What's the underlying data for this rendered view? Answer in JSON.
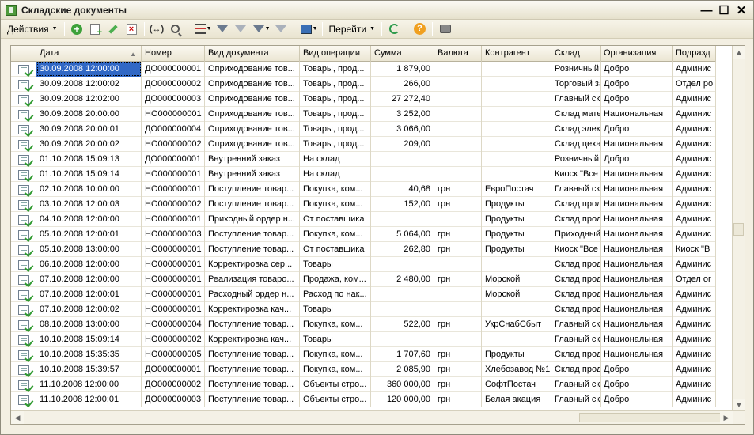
{
  "window": {
    "title": "Складские документы",
    "minimize": "—",
    "maximize": "☐",
    "close": "✕"
  },
  "toolbar": {
    "actions_label": "Действия",
    "goto_label": "Перейти",
    "swap_label": "(↔)",
    "dropdown_arrow": "▼"
  },
  "columns": [
    "",
    "Дата",
    "Номер",
    "Вид документа",
    "Вид операции",
    "Сумма",
    "Валюта",
    "Контрагент",
    "Склад",
    "Организация",
    "Подразд"
  ],
  "sort_indicator": "▲",
  "rows": [
    {
      "date": "30.09.2008 12:00:00",
      "number": "ДО000000001",
      "doc_type": "Оприходование тов...",
      "operation": "Товары, прод...",
      "sum": "1 879,00",
      "currency": "",
      "counterparty": "",
      "warehouse": "Розничный м...",
      "org": "Добро",
      "dept": "Админис"
    },
    {
      "date": "30.09.2008 12:00:02",
      "number": "ДО000000002",
      "doc_type": "Оприходование тов...",
      "operation": "Товары, прод...",
      "sum": "266,00",
      "currency": "",
      "counterparty": "",
      "warehouse": "Торговый зал",
      "org": "Добро",
      "dept": "Отдел ро"
    },
    {
      "date": "30.09.2008 12:02:00",
      "number": "ДО000000003",
      "doc_type": "Оприходование тов...",
      "operation": "Товары, прод...",
      "sum": "27 272,40",
      "currency": "",
      "counterparty": "",
      "warehouse": "Главный склад",
      "org": "Добро",
      "dept": "Админис"
    },
    {
      "date": "30.09.2008 20:00:00",
      "number": "НО000000001",
      "doc_type": "Оприходование тов...",
      "operation": "Товары, прод...",
      "sum": "3 252,00",
      "currency": "",
      "counterparty": "",
      "warehouse": "Склад матери...",
      "org": "Национальная",
      "dept": "Админис"
    },
    {
      "date": "30.09.2008 20:00:01",
      "number": "ДО000000004",
      "doc_type": "Оприходование тов...",
      "operation": "Товары, прод...",
      "sum": "3 066,00",
      "currency": "",
      "counterparty": "",
      "warehouse": "Склад электр...",
      "org": "Добро",
      "dept": "Админис"
    },
    {
      "date": "30.09.2008 20:00:02",
      "number": "НО000000002",
      "doc_type": "Оприходование тов...",
      "operation": "Товары, прод...",
      "sum": "209,00",
      "currency": "",
      "counterparty": "",
      "warehouse": "Склад цеха № 1",
      "org": "Национальная",
      "dept": "Админис"
    },
    {
      "date": "01.10.2008 15:09:13",
      "number": "ДО000000001",
      "doc_type": "Внутренний заказ",
      "operation": "На склад",
      "sum": "",
      "currency": "",
      "counterparty": "",
      "warehouse": "Розничный м...",
      "org": "Добро",
      "dept": "Админис"
    },
    {
      "date": "01.10.2008 15:09:14",
      "number": "НО000000001",
      "doc_type": "Внутренний заказ",
      "operation": "На склад",
      "sum": "",
      "currency": "",
      "counterparty": "",
      "warehouse": "Киоск \"Все д...",
      "org": "Национальная",
      "dept": "Админис"
    },
    {
      "date": "02.10.2008 10:00:00",
      "number": "НО000000001",
      "doc_type": "Поступление товар...",
      "operation": "Покупка, ком...",
      "sum": "40,68",
      "currency": "грн",
      "counterparty": "ЕвроПостач",
      "warehouse": "Главный склад",
      "org": "Национальная",
      "dept": "Админис"
    },
    {
      "date": "03.10.2008 12:00:03",
      "number": "НО000000002",
      "doc_type": "Поступление товар...",
      "operation": "Покупка, ком...",
      "sum": "152,00",
      "currency": "грн",
      "counterparty": "Продукты",
      "warehouse": "Склад продук...",
      "org": "Национальная",
      "dept": "Админис"
    },
    {
      "date": "04.10.2008 12:00:00",
      "number": "НО000000001",
      "doc_type": "Приходный ордер н...",
      "operation": "От поставщика",
      "sum": "",
      "currency": "",
      "counterparty": "Продукты",
      "warehouse": "Склад продук...",
      "org": "Национальная",
      "dept": "Админис"
    },
    {
      "date": "05.10.2008 12:00:01",
      "number": "НО000000003",
      "doc_type": "Поступление товар...",
      "operation": "Покупка, ком...",
      "sum": "5 064,00",
      "currency": "грн",
      "counterparty": "Продукты",
      "warehouse": "Приходный ор...",
      "org": "Национальная",
      "dept": "Админис"
    },
    {
      "date": "05.10.2008 13:00:00",
      "number": "НО000000001",
      "doc_type": "Поступление товар...",
      "operation": "От поставщика",
      "sum": "262,80",
      "currency": "грн",
      "counterparty": "Продукты",
      "warehouse": "Киоск \"Все д...",
      "org": "Национальная",
      "dept": "Киоск \"В"
    },
    {
      "date": "06.10.2008 12:00:00",
      "number": "НО000000001",
      "doc_type": "Корректировка сер...",
      "operation": "Товары",
      "sum": "",
      "currency": "",
      "counterparty": "",
      "warehouse": "Склад продук...",
      "org": "Национальная",
      "dept": "Админис"
    },
    {
      "date": "07.10.2008 12:00:00",
      "number": "НО000000001",
      "doc_type": "Реализация товаро...",
      "operation": "Продажа, ком...",
      "sum": "2 480,00",
      "currency": "грн",
      "counterparty": "Морской",
      "warehouse": "Склад продук...",
      "org": "Национальная",
      "dept": "Отдел ог"
    },
    {
      "date": "07.10.2008 12:00:01",
      "number": "НО000000001",
      "doc_type": "Расходный ордер н...",
      "operation": "Расход по нак...",
      "sum": "",
      "currency": "",
      "counterparty": "Морской",
      "warehouse": "Склад продук...",
      "org": "Национальная",
      "dept": "Админис"
    },
    {
      "date": "07.10.2008 12:00:02",
      "number": "НО000000001",
      "doc_type": "Корректировка кач...",
      "operation": "Товары",
      "sum": "",
      "currency": "",
      "counterparty": "",
      "warehouse": "Склад продук...",
      "org": "Национальная",
      "dept": "Админис"
    },
    {
      "date": "08.10.2008 13:00:00",
      "number": "НО000000004",
      "doc_type": "Поступление товар...",
      "operation": "Покупка, ком...",
      "sum": "522,00",
      "currency": "грн",
      "counterparty": "УкрСнабСбыт",
      "warehouse": "Главный склад",
      "org": "Национальная",
      "dept": "Админис"
    },
    {
      "date": "10.10.2008 15:09:14",
      "number": "НО000000002",
      "doc_type": "Корректировка кач...",
      "operation": "Товары",
      "sum": "",
      "currency": "",
      "counterparty": "",
      "warehouse": "Главный склад",
      "org": "Национальная",
      "dept": "Админис"
    },
    {
      "date": "10.10.2008 15:35:35",
      "number": "НО000000005",
      "doc_type": "Поступление товар...",
      "operation": "Покупка, ком...",
      "sum": "1 707,60",
      "currency": "грн",
      "counterparty": "Продукты",
      "warehouse": "Склад продук...",
      "org": "Национальная",
      "dept": "Админис"
    },
    {
      "date": "10.10.2008 15:39:57",
      "number": "ДО000000001",
      "doc_type": "Поступление товар...",
      "operation": "Покупка, ком...",
      "sum": "2 085,90",
      "currency": "грн",
      "counterparty": "Хлебозавод №1",
      "warehouse": "Склад продук...",
      "org": "Добро",
      "dept": "Админис"
    },
    {
      "date": "11.10.2008 12:00:00",
      "number": "ДО000000002",
      "doc_type": "Поступление товар...",
      "operation": "Объекты стро...",
      "sum": "360 000,00",
      "currency": "грн",
      "counterparty": "СофтПостач",
      "warehouse": "Главный склад",
      "org": "Добро",
      "dept": "Админис"
    },
    {
      "date": "11.10.2008 12:00:01",
      "number": "ДО000000003",
      "doc_type": "Поступление товар...",
      "operation": "Объекты стро...",
      "sum": "120 000,00",
      "currency": "грн",
      "counterparty": "Белая акация",
      "warehouse": "Главный склад",
      "org": "Добро",
      "dept": "Админис"
    }
  ],
  "selected_row": 0,
  "scroll": {
    "up": "▲",
    "down": "▼",
    "left": "◀",
    "right": "▶"
  }
}
